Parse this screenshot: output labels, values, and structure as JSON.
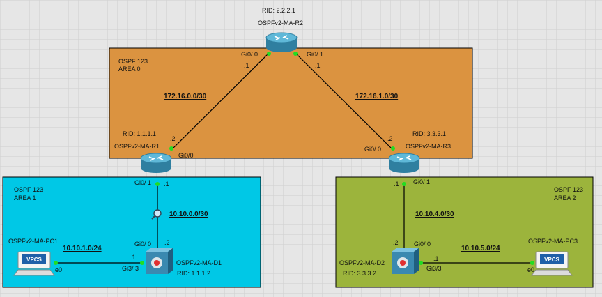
{
  "areas": {
    "area0": {
      "line1": "OSPF 123",
      "line2": "AREA 0"
    },
    "area1": {
      "line1": "OSPF 123",
      "line2": "AREA 1"
    },
    "area2": {
      "line1": "OSPF 123",
      "line2": "AREA 2"
    }
  },
  "colors": {
    "area0": "#db9340",
    "area1": "#00c8e6",
    "area2": "#9cb43c",
    "grid_bg": "#e6e6e6",
    "link": "#000000",
    "port_up": "#22dd22"
  },
  "devices": {
    "r2": {
      "name": "OSPFv2-MA-R2",
      "rid": "RID: 2.2.2.1"
    },
    "r1": {
      "name": "OSPFv2-MA-R1",
      "rid": "RID: 1.1.1.1"
    },
    "r3": {
      "name": "OSPFv2-MA-R3",
      "rid": "RID: 3.3.3.1"
    },
    "d1": {
      "name": "OSPFv2-MA-D1",
      "rid": "RID: 1.1.1.2"
    },
    "d2": {
      "name": "OSPFv2-MA-D2",
      "rid": "RID: 3.3.3.2"
    },
    "pc1": {
      "name": "OSPFv2-MA-PC1",
      "badge": "VPCS"
    },
    "pc3": {
      "name": "OSPFv2-MA-PC3",
      "badge": "VPCS"
    }
  },
  "networks": {
    "r1_r2": "172.16.0.0/30",
    "r2_r3": "172.16.1.0/30",
    "r1_d1": "10.10.0.0/30",
    "pc1_d1": "10.10.1.0/24",
    "r3_d2": "10.10.4.0/30",
    "d2_pc3": "10.10.5.0/24"
  },
  "ports": {
    "r2_gi00": "Gi0/ 0",
    "r2_gi01": "Gi0/ 1",
    "r2_ip_left": ".1",
    "r2_ip_right": ".1",
    "r1_ip_up": ".2",
    "r1_gi00": "Gi0/0",
    "r1_gi01": "Gi0/ 1",
    "r1_ip_down": ".1",
    "r3_ip_up": ".2",
    "r3_gi00": "Gi0/ 0",
    "r3_gi01": "Gi0/ 1",
    "r3_ip_down": ".1",
    "d1_gi00": "Gi0/ 0",
    "d1_ip_up": ".2",
    "d1_gi33": "Gi3/ 3",
    "d1_ip_left": ".1",
    "pc1_e0": "e0",
    "d2_gi00": "Gi0/ 0",
    "d2_ip_up": ".2",
    "d2_gi33": "Gi3/3",
    "d2_ip_right": ".1",
    "pc3_e0": "e0"
  }
}
